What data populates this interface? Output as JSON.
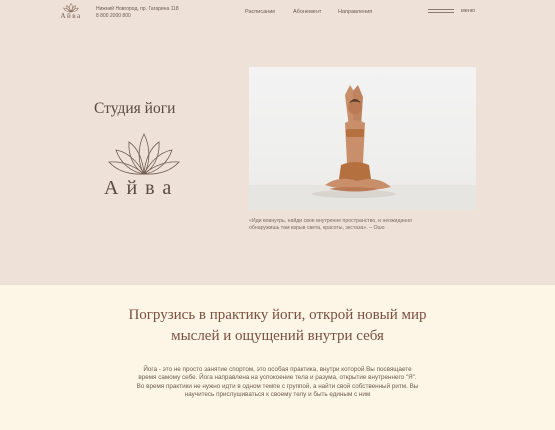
{
  "header": {
    "logo_text": "Айва",
    "address": "Нижний Новгород, пр. Гагарина 118",
    "phone": "8 800 2000 800",
    "nav": [
      {
        "label": "Расписание"
      },
      {
        "label": "Абонемент"
      },
      {
        "label": "Направления"
      }
    ],
    "menu_label": "меню"
  },
  "hero": {
    "title": "Студия йоги",
    "brand_name": "Айва",
    "quote": "«Иди вовнутрь, найди свое внутренне пространство, и неожиданно обнаружишь там взрыв света, красоты, экстаза». – Ошо"
  },
  "intro": {
    "headline_line1": "Погрузись в практику йоги, открой новый мир",
    "headline_line2": "мыслей и ощущений внутри себя",
    "paragraph": "Йога - это не просто занятие спортом, это особая практика, внутри которой Вы посвящаете время самому себе. Йога направлена на успокоение тела и разума, открытие внутреннего \"Я\". Во время практики не нужно идти в одном темпе с группой, а найти свой собственный ритм. Вы научитесь прислушиваться к своему телу и быть единым с ним"
  },
  "colors": {
    "hero_bg": "#ede1d8",
    "section_bg": "#fdf6e7",
    "headline": "#7a5040",
    "text": "#5a4a3f"
  }
}
